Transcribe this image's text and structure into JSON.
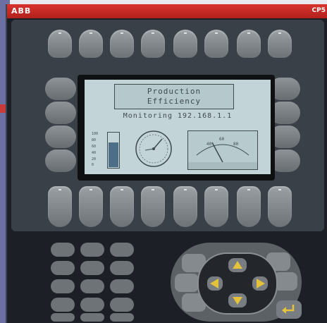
{
  "brand": {
    "logo": "ABB",
    "model": "CP5"
  },
  "screen": {
    "title_line1": "Production",
    "title_line2": "Efficiency",
    "subtitle": "Monitoring 192.168.1.1",
    "bar_level": 0.72,
    "bar_scale": [
      "100",
      "80",
      "60",
      "40",
      "20",
      "0"
    ],
    "meter_scale": [
      "40",
      "60",
      "80"
    ]
  },
  "function_keys": {
    "count": 8
  },
  "softkeys": {
    "count": 8
  },
  "keypad": {
    "rows": 5,
    "cols": 3
  },
  "colors": {
    "brand": "#c62b27",
    "panel": "#1c2026",
    "screen": "#c3d4d8",
    "arrow": "#e5c23a"
  }
}
